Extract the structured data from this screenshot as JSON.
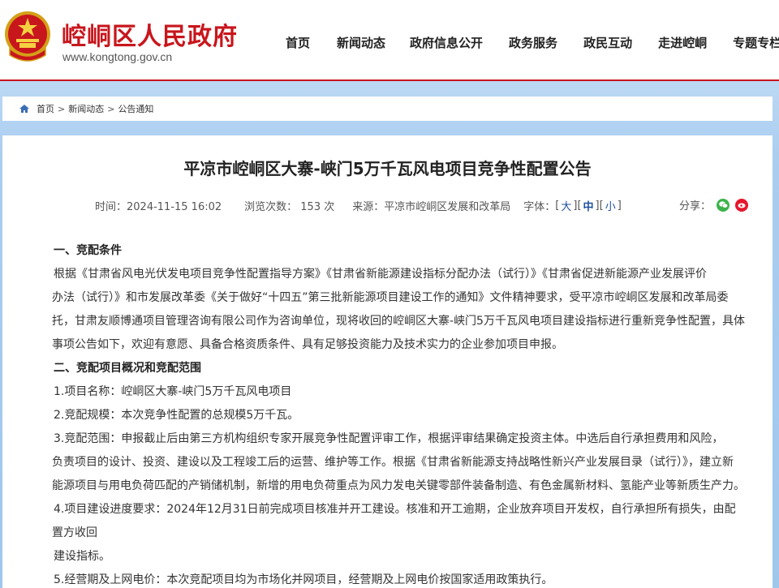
{
  "site": {
    "title": "崆峒区人民政府",
    "url": "www.kongtong.gov.cn",
    "brand_color": "#c8161d"
  },
  "nav": {
    "items": [
      "首页",
      "新闻动态",
      "政府信息公开",
      "政务服务",
      "政民互动",
      "走进崆峒",
      "专题专栏"
    ]
  },
  "breadcrumb": {
    "icon": "home-icon",
    "items": [
      "首页",
      "新闻动态",
      "公告通知"
    ],
    "separator": ">"
  },
  "article": {
    "title": "平凉市崆峒区大寨-峡门5万千瓦风电项目竞争性配置公告",
    "meta": {
      "time": "时间：2024-11-15 16:02",
      "views": "浏览次数： 153 次",
      "source": "来源：平凉市崆峒区发展和改革局",
      "fontsize_label": "字体：",
      "large": "大",
      "medium": "中",
      "small": "小"
    },
    "share_label": "分享：",
    "paragraphs": [
      "一、竞配条件",
      "根据《甘肃省风电光伏发电项目竞争性配置指导方案》《甘肃省新能源建设指标分配办法（试行）》《甘肃省促进新能源产业发展评价",
      "办法（试行）》和市发展改革委《关于做好“十四五”第三批新能源项目建设工作的通知》文件精神要求，受平凉市崆峒区发展和改革局委",
      "托，甘肃友顺博通项目管理咨询有限公司作为咨询单位，现将收回的崆峒区大寨-峡门5万千瓦风电项目建设指标进行重新竞争性配置，具体",
      "事项公告如下，欢迎有意愿、具备合格资质条件、具有足够投资能力及技术实力的企业参加项目申报。",
      "二、竞配项目概况和竞配范围",
      "1.项目名称：崆峒区大寨-峡门5万千瓦风电项目",
      "2.竞配规模：本次竞争性配置的总规模5万千瓦。",
      "3.竞配范围：申报截止后由第三方机构组织专家开展竞争性配置评审工作，根据评审结果确定投资主体。中选后自行承担费用和风险，",
      "负责项目的设计、投资、建设以及工程竣工后的运营、维护等工作。根据《甘肃省新能源支持战略性新兴产业发展目录（试行）》，建立新",
      "能源项目与用电负荷匹配的产销储机制，新增的用电负荷重点为风力发电关键零部件装备制造、有色金属新材料、氢能产业等新质生产力。",
      "4.项目建设进度要求：2024年12月31日前完成项目核准并开工建设。核准和开工逾期，企业放弃项目开发权，自行承担所有损失，由配",
      "置方收回",
      "建设指标。",
      "5.经营期及上网电价：本次竞配项目均为市场化并网项目，经营期及上网电价按国家适用政策执行。"
    ]
  }
}
